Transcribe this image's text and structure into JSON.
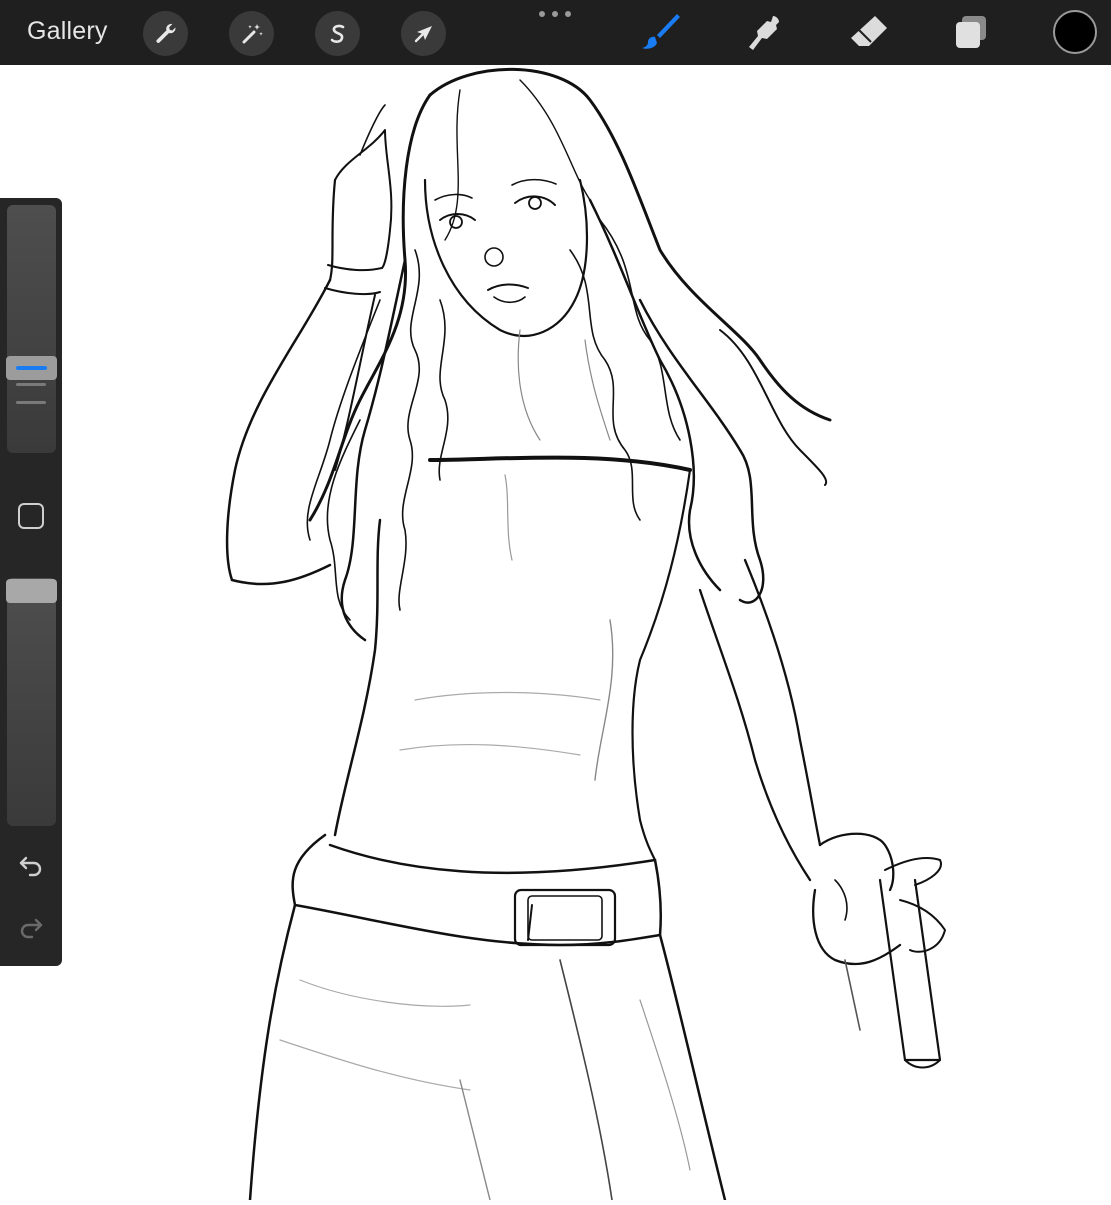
{
  "toolbar": {
    "gallery_label": "Gallery",
    "left_tools": [
      "wrench-icon",
      "magic-wand-icon",
      "selection-s-icon",
      "transform-arrow-icon"
    ],
    "right_tools": [
      "brush-icon",
      "smudge-icon",
      "eraser-icon",
      "layers-icon"
    ],
    "active_tool": "brush",
    "colors": {
      "bar": "#1f1f1f",
      "active": "#1a7cf3",
      "current_color": "#000000"
    }
  },
  "sidebar": {
    "controls": [
      "brush-size-slider",
      "modify-button",
      "opacity-slider",
      "undo-button",
      "redo-button"
    ],
    "redo_enabled": false
  }
}
